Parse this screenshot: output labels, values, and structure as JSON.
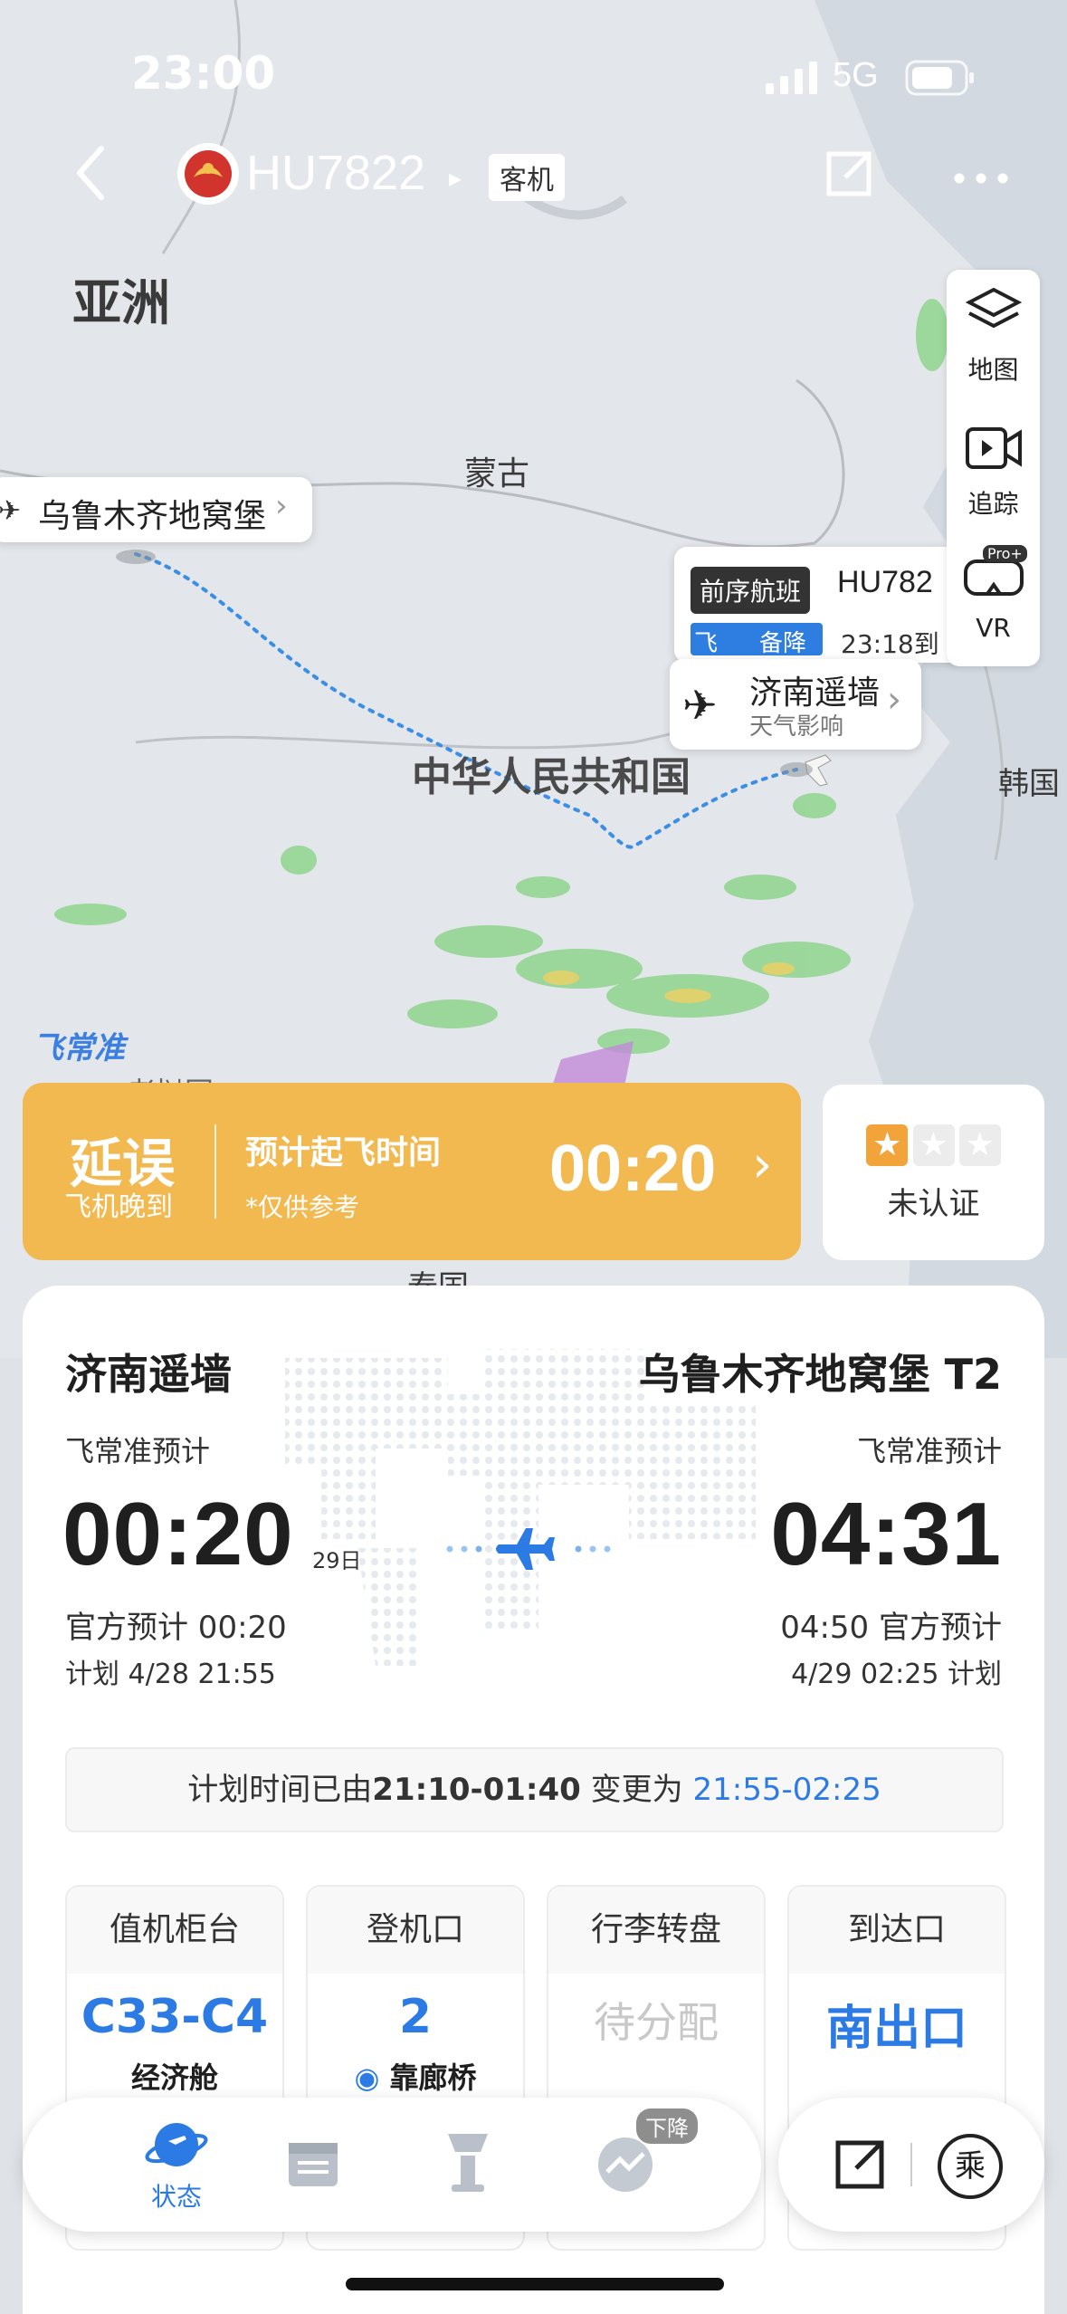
{
  "status_bar": {
    "time": "23:00",
    "network": "5G"
  },
  "header": {
    "flight_number": "HU7822",
    "aircraft_type": "客机"
  },
  "map": {
    "labels": {
      "asia": "亚洲",
      "mongolia": "蒙古",
      "china": "中华人民共和国",
      "korea": "韩国",
      "thailand": "泰国",
      "watermark": "飞常准",
      "laos_partial": "老挝国"
    },
    "origin_pin": "乌鲁木齐地窝堡",
    "dest_pin": {
      "title": "济南遥墙",
      "subtitle": "天气影响"
    },
    "previous_flight": {
      "tag": "前序航班",
      "flight": "HU782",
      "status": "备降",
      "status_prefix": "飞",
      "time_text": "23:18到"
    }
  },
  "tools": {
    "map": "地图",
    "track": "追踪",
    "vr": "VR",
    "vr_badge": "Pro+"
  },
  "delay_banner": {
    "status": "延误",
    "reason": "飞机晚到",
    "label": "预计起飞时间",
    "note": "*仅供参考",
    "time": "00:20"
  },
  "certification": {
    "label": "未认证",
    "stars_filled": 1,
    "stars_total": 3
  },
  "route": {
    "departure": {
      "airport": "济南遥墙",
      "source": "飞常准预计",
      "time": "00:20",
      "day": "29日",
      "official": "官方预计 00:20",
      "planned": "计划 4/28 21:55"
    },
    "arrival": {
      "airport": "乌鲁木齐地窝堡 T2",
      "source": "飞常准预计",
      "time": "04:31",
      "official": "04:50 官方预计",
      "planned": "4/29 02:25 计划"
    }
  },
  "schedule_change": {
    "prefix": "计划时间已由",
    "old": "21:10-01:40",
    "middle": " 变更为 ",
    "new": "21:55-02:25"
  },
  "info_cells": [
    {
      "header": "值机柜台",
      "value": "C33-C4",
      "sub": "经济舱"
    },
    {
      "header": "登机口",
      "value": "2",
      "sub": "靠廊桥"
    },
    {
      "header": "行李转盘",
      "value": "待分配",
      "sub": ""
    },
    {
      "header": "到达口",
      "value": "南出口",
      "sub": ""
    }
  ],
  "bottom_nav": {
    "status_label": "状态",
    "landing_badge": "下降",
    "ride_label": "乘"
  },
  "colors": {
    "delay": "#f2b950",
    "accent_blue": "#2c7be5",
    "route_line": "#3a8ee6",
    "star_active": "#f2a33a"
  }
}
